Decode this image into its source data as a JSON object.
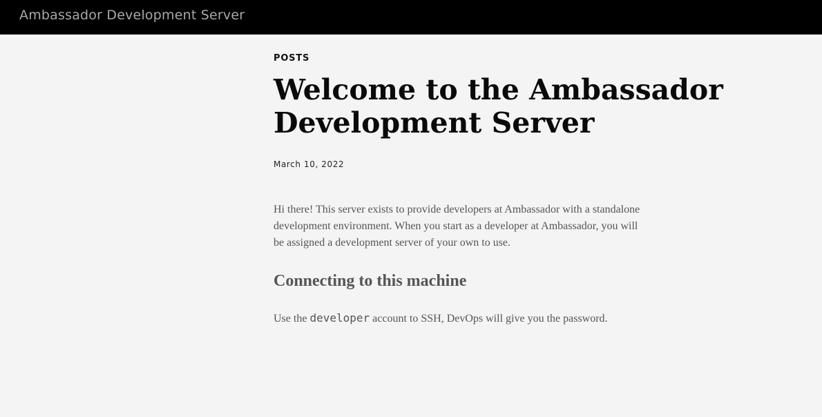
{
  "header": {
    "site_title": "Ambassador Development Server"
  },
  "post": {
    "category": "POSTS",
    "title": "Welcome to the Ambassador Development Server",
    "date": "March 10, 2022",
    "intro": "Hi there! This server exists to provide developers at Ambassador with a standalone development environment. When you start as a developer at Ambassador, you will be assigned a development server of your own to use.",
    "section_heading": "Connecting to this machine",
    "usage_prefix": "Use the ",
    "usage_code": "developer",
    "usage_suffix": " account to SSH, DevOps will give you the password."
  },
  "colors": {
    "header_bg": "#000000",
    "page_bg": "#f4f4f4",
    "body_text": "#555555"
  }
}
